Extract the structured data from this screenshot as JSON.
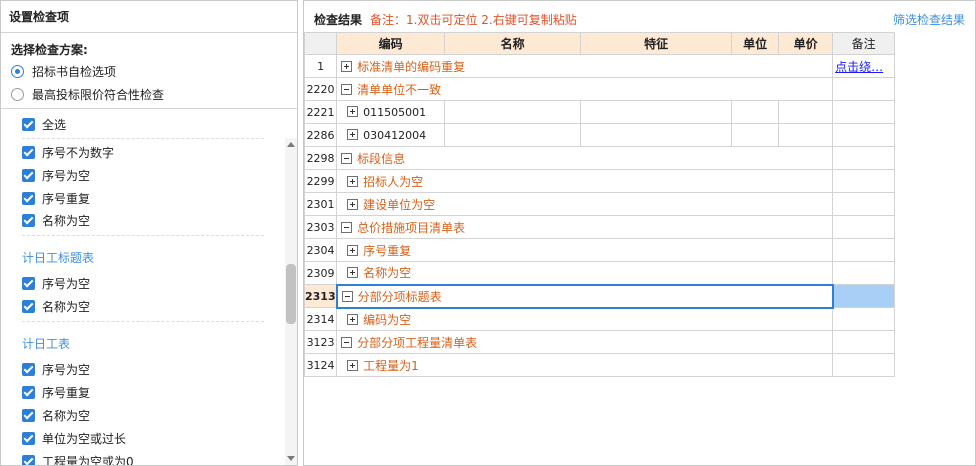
{
  "left_panel": {
    "title": "设置检查项",
    "scheme_label": "选择检查方案:",
    "schemes": [
      {
        "label": "招标书自检选项",
        "selected": true
      },
      {
        "label": "最高投标限价符合性检查",
        "selected": false
      }
    ],
    "select_all": "全选",
    "groups": [
      {
        "title": "",
        "items": [
          "序号不为数字",
          "序号为空",
          "序号重复",
          "名称为空"
        ]
      },
      {
        "title": "计日工标题表",
        "items": [
          "序号为空",
          "名称为空"
        ]
      },
      {
        "title": "计日工表",
        "items": [
          "序号为空",
          "序号重复",
          "名称为空",
          "单位为空或过长",
          "工程量为空或为0"
        ]
      }
    ]
  },
  "right_panel": {
    "title": "检查结果",
    "note": "备注：1.双击可定位 2.右键可复制粘贴",
    "filter_label": "筛选检查结果",
    "columns": [
      "编码",
      "名称",
      "特征",
      "单位",
      "单价",
      "备注"
    ],
    "note_link": "点击绕…",
    "rows": [
      {
        "num": "1",
        "text": "标准清单的编码重复",
        "level": 0,
        "icon": "plus",
        "note": "点击绕…"
      },
      {
        "num": "2220",
        "text": "清单单位不一致",
        "level": 0,
        "icon": "minus"
      },
      {
        "num": "2221",
        "text": "011505001",
        "level": 1,
        "icon": "plus",
        "code_only": true
      },
      {
        "num": "2286",
        "text": "030412004",
        "level": 1,
        "icon": "plus",
        "code_only": true
      },
      {
        "num": "2298",
        "text": "标段信息",
        "level": 0,
        "icon": "minus"
      },
      {
        "num": "2299",
        "text": "招标人为空",
        "level": 1,
        "icon": "plus"
      },
      {
        "num": "2301",
        "text": "建设单位为空",
        "level": 1,
        "icon": "plus"
      },
      {
        "num": "2303",
        "text": "总价措施项目清单表",
        "level": 0,
        "icon": "minus"
      },
      {
        "num": "2304",
        "text": "序号重复",
        "level": 1,
        "icon": "plus"
      },
      {
        "num": "2309",
        "text": "名称为空",
        "level": 1,
        "icon": "plus"
      },
      {
        "num": "2313",
        "text": "分部分项标题表",
        "level": 0,
        "icon": "minus",
        "selected": true
      },
      {
        "num": "2314",
        "text": "编码为空",
        "level": 1,
        "icon": "plus"
      },
      {
        "num": "3123",
        "text": "分部分项工程量清单表",
        "level": 0,
        "icon": "minus"
      },
      {
        "num": "3124",
        "text": "工程量为1",
        "level": 1,
        "icon": "plus"
      }
    ]
  },
  "colors": {
    "accent": "#2d7fd8",
    "header_bg": "#fde9d4",
    "error_text": "#d86018",
    "note_text": "#e0522b"
  }
}
